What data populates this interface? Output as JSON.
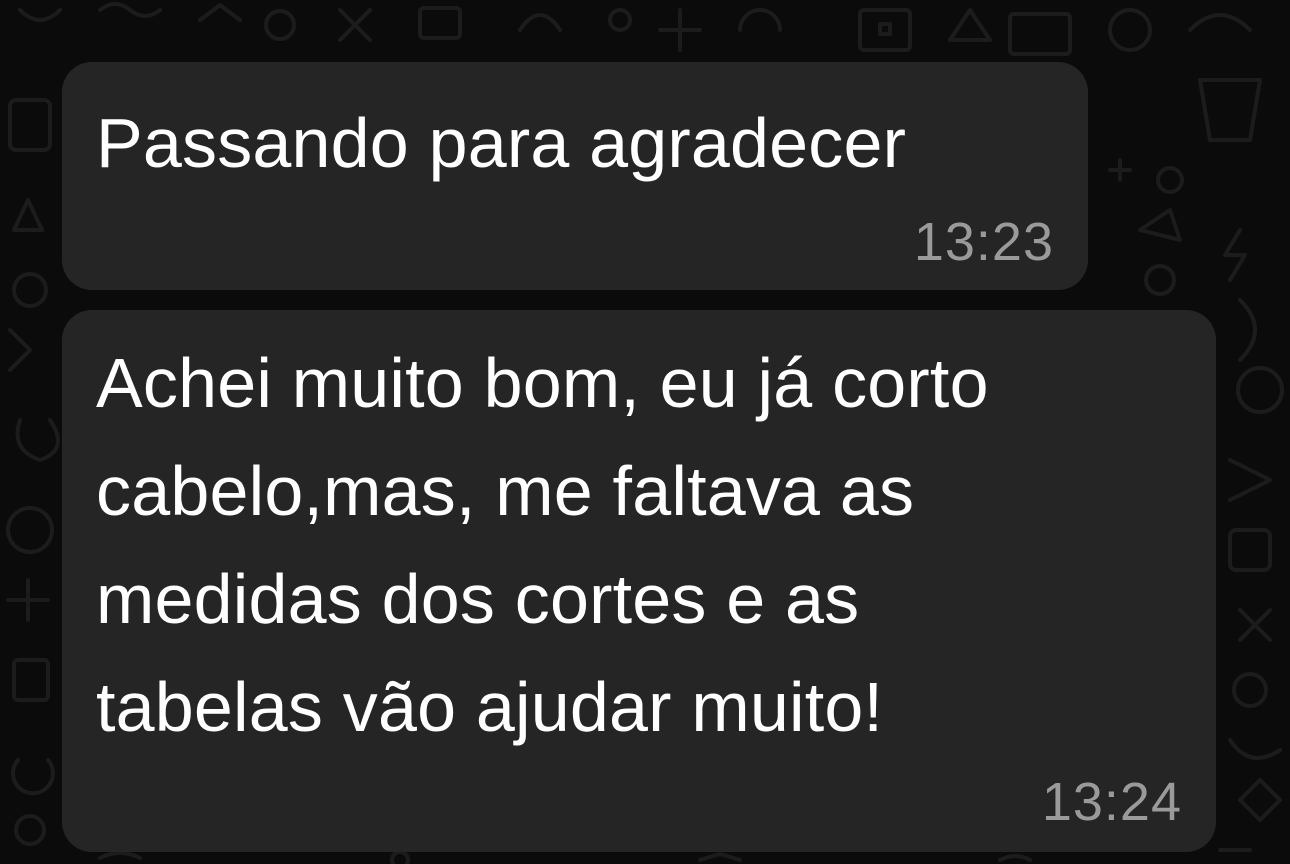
{
  "chat": {
    "background_color": "#0b0b0b",
    "bubble_color": "#252525",
    "messages": [
      {
        "lines": [
          "Passando para agradecer"
        ],
        "time": "13:23"
      },
      {
        "lines": [
          "Achei muito bom, eu já corto",
          "cabelo,mas, me faltava as",
          "medidas dos cortes e as",
          "tabelas vão ajudar muito!"
        ],
        "time": "13:24"
      }
    ]
  }
}
